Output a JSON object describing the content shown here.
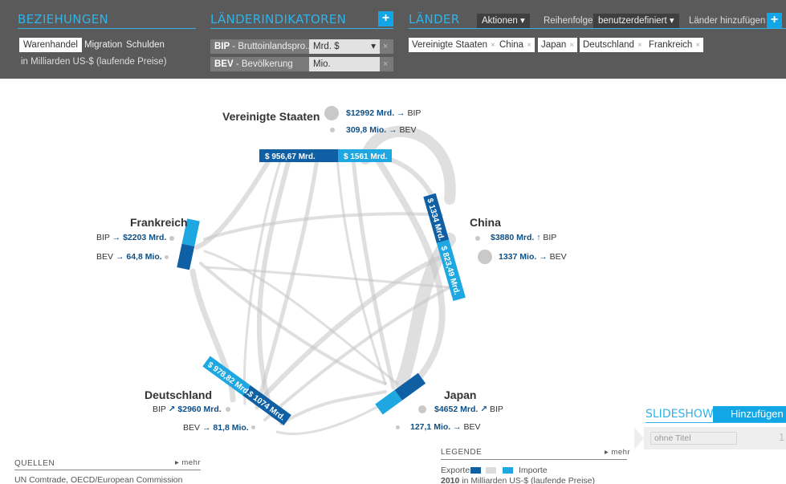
{
  "header": {
    "relations": {
      "title": "BEZIEHUNGEN",
      "tabs": [
        {
          "label": "Warenhandel",
          "active": true
        },
        {
          "label": "Migration",
          "active": false
        },
        {
          "label": "Schulden",
          "active": false
        }
      ],
      "subtitle": "in Milliarden US-$ (laufende Preise)"
    },
    "indicators": {
      "title": "LÄNDERINDIKATOREN",
      "add": "+",
      "rows": [
        {
          "code": "BIP",
          "name": " - Bruttoinlandspro...",
          "unit": "Mrd. $",
          "dropdown": "▾",
          "remove": "×"
        },
        {
          "code": "BEV",
          "name": " - Bevölkerung",
          "unit": "Mio.",
          "remove": "×"
        }
      ]
    },
    "countries": {
      "title": "LÄNDER",
      "actions_label": "Aktionen ▾",
      "order_label": "Reihenfolge:",
      "order_value": "benutzerdefiniert ▾",
      "add_label": "Länder hinzufügen",
      "add": "+",
      "tags": [
        {
          "label": "Vereinigte Staaten",
          "x": "×"
        },
        {
          "label": "China",
          "x": "×"
        },
        {
          "label": "Japan",
          "x": "×"
        },
        {
          "label": "Deutschland",
          "x": "×"
        },
        {
          "label": "Frankreich",
          "x": "×"
        }
      ]
    }
  },
  "diagram": {
    "colors": {
      "export": "#0e5fa3",
      "import": "#1ea7e1",
      "flow": "#b9b9b9",
      "dot": "#c9c9c9"
    },
    "countries": {
      "usa": {
        "name": "Vereinigte Staaten",
        "bip": "$12992 Mrd.",
        "bip_arrow": "→",
        "bip_unit": "BIP",
        "bev": "309,8 Mio.",
        "bev_arrow": "→",
        "bev_unit": "BEV",
        "export_label": "$ 956,67 Mrd.",
        "import_label": "$ 1561 Mrd."
      },
      "china": {
        "name": "China",
        "bip": "$3880 Mrd.",
        "bip_arrow": "↑",
        "bip_unit": "BIP",
        "bev": "1337 Mio.",
        "bev_arrow": "→",
        "bev_unit": "BEV",
        "export_label": "$ 1334 Mrd.",
        "import_label": "$ 823,49 Mrd."
      },
      "japan": {
        "name": "Japan",
        "bip": "$4652 Mrd.",
        "bip_arrow": "↗",
        "bip_unit": "BIP",
        "bev": "127,1 Mio.",
        "bev_arrow": "→",
        "bev_unit": "BEV"
      },
      "germany": {
        "name": "Deutschland",
        "bip_unit": "BIP",
        "bip_arrow": "↗",
        "bip": "$2960 Mrd.",
        "bev_unit": "BEV",
        "bev_arrow": "→",
        "bev": "81,8 Mio.",
        "export_label": "$ 978,82 Mrd.",
        "import_label": "$ 1074 Mrd."
      },
      "france": {
        "name": "Frankreich",
        "bip_unit": "BIP",
        "bip_arrow": "→",
        "bip": "$2203 Mrd.",
        "bev_unit": "BEV",
        "bev_arrow": "→",
        "bev": "64,8 Mio."
      }
    }
  },
  "sources": {
    "title": "QUELLEN",
    "more": "▸ mehr",
    "text": "UN Comtrade, OECD/European Commission"
  },
  "legend": {
    "title": "LEGENDE",
    "more": "▸ mehr",
    "exports": "Exporte",
    "imports": "Importe",
    "year": "2010",
    "unit_note": "in Milliarden US-$ (laufende Preise)"
  },
  "slideshow": {
    "title": "SLIDESHOW",
    "add": "Hinzufügen",
    "placeholder": "ohne Titel",
    "count": "1"
  }
}
